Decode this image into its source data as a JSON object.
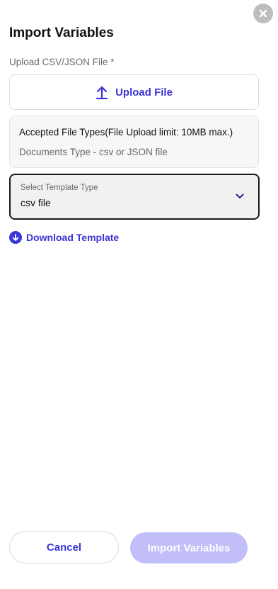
{
  "dialog": {
    "title": "Import Variables",
    "upload_label": "Upload CSV/JSON File *"
  },
  "upload": {
    "button_label": "Upload File",
    "icon": "upload-arrow-icon"
  },
  "file_info": {
    "title": "Accepted File Types(File Upload limit: 10MB max.)",
    "subtitle": "Documents Type - csv or JSON file"
  },
  "template_select": {
    "caption": "Select Template Type",
    "value": "csv file",
    "icon": "chevron-down-icon"
  },
  "download": {
    "label": "Download Template",
    "icon": "download-circle-icon"
  },
  "footer": {
    "cancel_label": "Cancel",
    "import_label": "Import Variables",
    "import_disabled": true
  },
  "colors": {
    "accent": "#3b34d4",
    "accent_disabled": "#c2befa",
    "close_bg": "#bdbdbd"
  }
}
